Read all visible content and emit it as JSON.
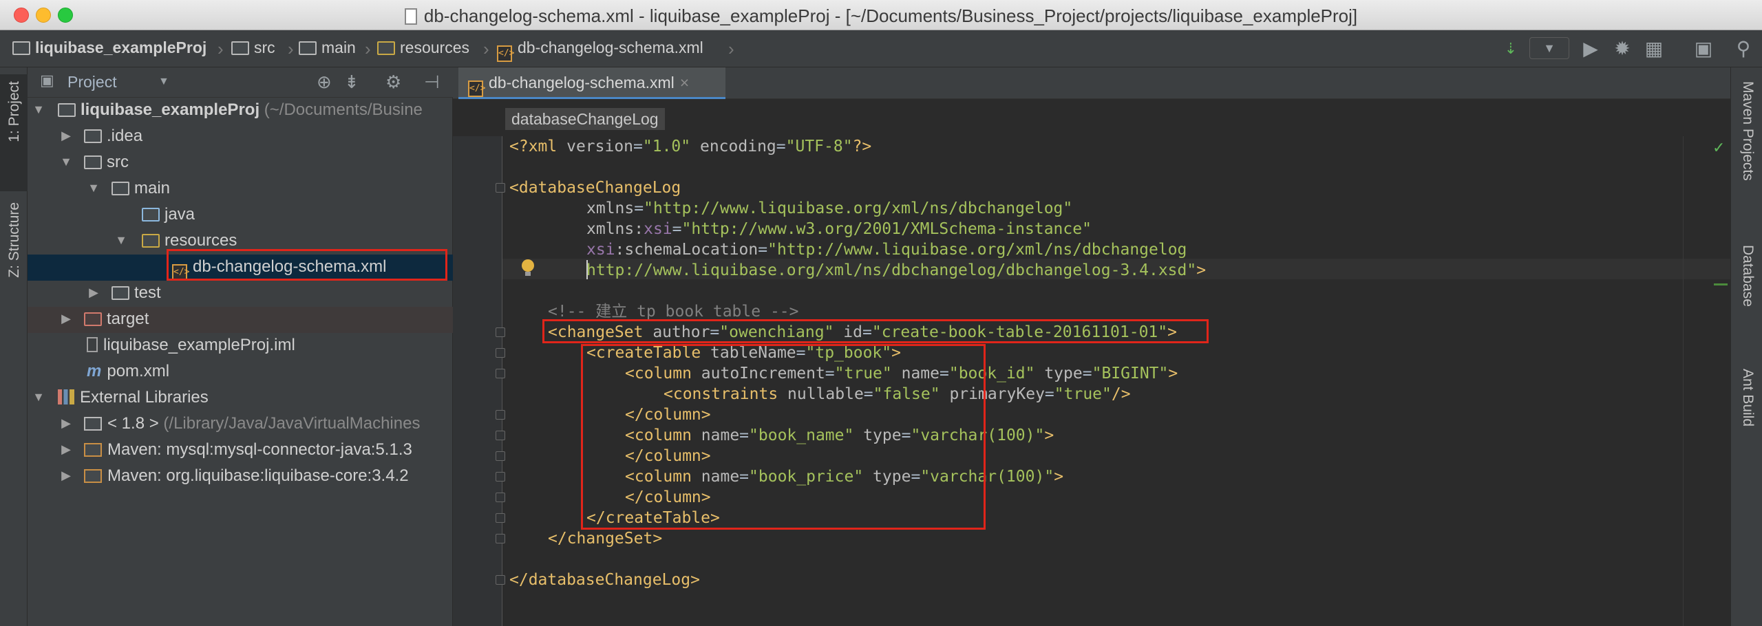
{
  "window": {
    "title": "db-changelog-schema.xml - liquibase_exampleProj - [~/Documents/Business_Project/projects/liquibase_exampleProj]"
  },
  "navbar": {
    "crumbs": [
      "liquibase_exampleProj",
      "src",
      "main",
      "resources",
      "db-changelog-schema.xml"
    ]
  },
  "left_stripe": {
    "project_tab": "1: Project",
    "structure_tab": "Z: Structure"
  },
  "right_stripe": {
    "maven_tab": "Maven Projects",
    "database_tab": "Database",
    "ant_tab": "Ant Build"
  },
  "project_panel": {
    "view_label": "Project",
    "tree": [
      {
        "label": "liquibase_exampleProj",
        "suffix": "(~/Documents/Busine"
      },
      {
        "label": ".idea"
      },
      {
        "label": "src"
      },
      {
        "label": "main"
      },
      {
        "label": "java"
      },
      {
        "label": "resources"
      },
      {
        "label": "db-changelog-schema.xml"
      },
      {
        "label": "test"
      },
      {
        "label": "target"
      },
      {
        "label": "liquibase_exampleProj.iml"
      },
      {
        "label": "pom.xml"
      },
      {
        "label": "External Libraries"
      },
      {
        "label": "< 1.8 >",
        "suffix": "(/Library/Java/JavaVirtualMachines"
      },
      {
        "label": "Maven: mysql:mysql-connector-java:5.1.3"
      },
      {
        "label": "Maven: org.liquibase:liquibase-core:3.4.2"
      }
    ]
  },
  "editor": {
    "tab_label": "db-changelog-schema.xml",
    "tag_breadcrumb": "databaseChangeLog",
    "lines": {
      "l1": {
        "a": "<?xml ",
        "b": "version",
        "c": "=",
        "d": "\"1.0\"",
        "e": " encoding",
        "f": "=",
        "g": "\"UTF-8\"",
        "h": "?>"
      },
      "l3": {
        "a": "<databaseChangeLog"
      },
      "l4": {
        "a": "xmlns",
        "b": "=",
        "c": "\"http://www.liquibase.org/xml/ns/dbchangelog\""
      },
      "l5": {
        "a": "xmlns:",
        "b": "xsi",
        "c": "=",
        "d": "\"http://www.w3.org/2001/XMLSchema-instance\""
      },
      "l6": {
        "a": "xsi",
        "b": ":schemaLocation",
        "c": "=",
        "d": "\"http://www.liquibase.org/xml/ns/dbchangelog"
      },
      "l7": {
        "a": "http://www.liquibase.org/xml/ns/dbchangelog/dbchangelog-3.4.xsd\"",
        "b": ">"
      },
      "l9": {
        "a": "<!-- 建立 tp_book table -->"
      },
      "l10": {
        "a": "<changeSet ",
        "b": "author",
        "c": "=",
        "d": "\"owenchiang\"",
        "e": " id",
        "f": "=",
        "g": "\"create-book-table-20161101-01\"",
        "h": ">"
      },
      "l11": {
        "a": "<createTable ",
        "b": "tableName",
        "c": "=",
        "d": "\"tp_book\"",
        "e": ">"
      },
      "l12": {
        "a": "<column ",
        "b": "autoIncrement",
        "c": "=",
        "d": "\"true\"",
        "e": " name",
        "f": "=",
        "g": "\"book_id\"",
        "h": " type",
        "i": "=",
        "j": "\"BIGINT\"",
        "k": ">"
      },
      "l13": {
        "a": "<constraints ",
        "b": "nullable",
        "c": "=",
        "d": "\"false\"",
        "e": " primaryKey",
        "f": "=",
        "g": "\"true\"",
        "h": "/>"
      },
      "l14": {
        "a": "</column>"
      },
      "l15": {
        "a": "<column ",
        "b": "name",
        "c": "=",
        "d": "\"book_name\"",
        "e": " type",
        "f": "=",
        "g": "\"varchar(100)\"",
        "h": ">"
      },
      "l16": {
        "a": "</column>"
      },
      "l17": {
        "a": "<column ",
        "b": "name",
        "c": "=",
        "d": "\"book_price\"",
        "e": " type",
        "f": "=",
        "g": "\"varchar(100)\"",
        "h": ">"
      },
      "l18": {
        "a": "</column>"
      },
      "l19": {
        "a": "</createTable>"
      },
      "l20": {
        "a": "</changeSet>"
      },
      "l22": {
        "a": "</databaseChangeLog>"
      }
    }
  },
  "colors": {
    "editor_bg": "#2b2b2b",
    "panel_bg": "#3c3f41",
    "tag": "#e8bf6a",
    "attr_value": "#a5c25c",
    "comment": "#808080",
    "highlight_box": "#e0251a",
    "selection": "#0d293e"
  }
}
